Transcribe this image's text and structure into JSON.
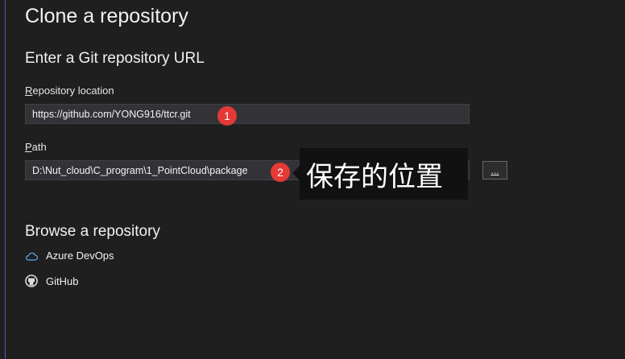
{
  "header": {
    "title": "Clone a repository"
  },
  "clone": {
    "section_title": "Enter a Git repository URL",
    "repo_label_first": "R",
    "repo_label_rest": "epository location",
    "repo_value": "https://github.com/YONG916/ttcr.git",
    "path_label_first": "P",
    "path_label_rest": "ath",
    "path_value": "D:\\Nut_cloud\\C_program\\1_PointCloud\\package",
    "browse_label": "..."
  },
  "annotations": {
    "badge1": "1",
    "badge2": "2",
    "tooltip_text": "保存的位置",
    "badge_color": "#e53935"
  },
  "browse": {
    "section_title": "Browse a repository",
    "items": [
      {
        "label": "Azure DevOps",
        "icon": "cloud-icon"
      },
      {
        "label": "GitHub",
        "icon": "github-icon"
      }
    ]
  }
}
